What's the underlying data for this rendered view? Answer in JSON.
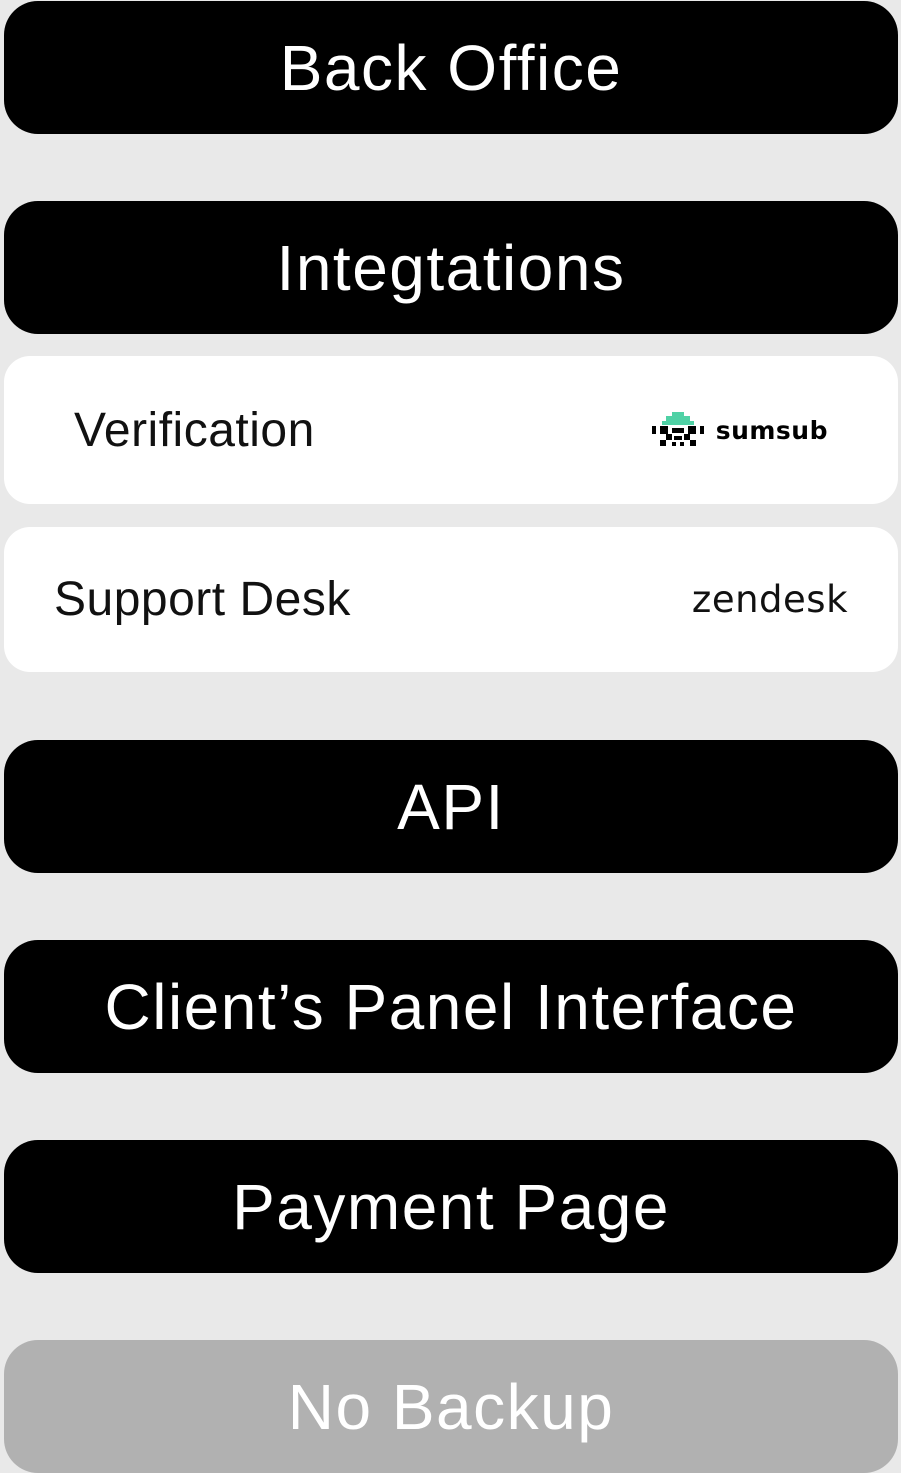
{
  "sections": {
    "back_office": "Back Office",
    "integrations": "Integtations",
    "api": "API",
    "clients_panel": "Client’s Panel Interface",
    "payment_page": "Payment Page",
    "no_backup": "No Backup"
  },
  "integrations": {
    "verification": {
      "label": "Verification",
      "provider": "sumsub",
      "icon": "sumsub-logo-icon",
      "icon_accent": "#4fd1a5"
    },
    "support_desk": {
      "label": "Support Desk",
      "provider": "zendesk"
    }
  },
  "colors": {
    "background": "#e9e9e9",
    "bar": "#000000",
    "bar_disabled": "#b1b1b1",
    "card": "#ffffff",
    "text_light": "#ffffff"
  }
}
